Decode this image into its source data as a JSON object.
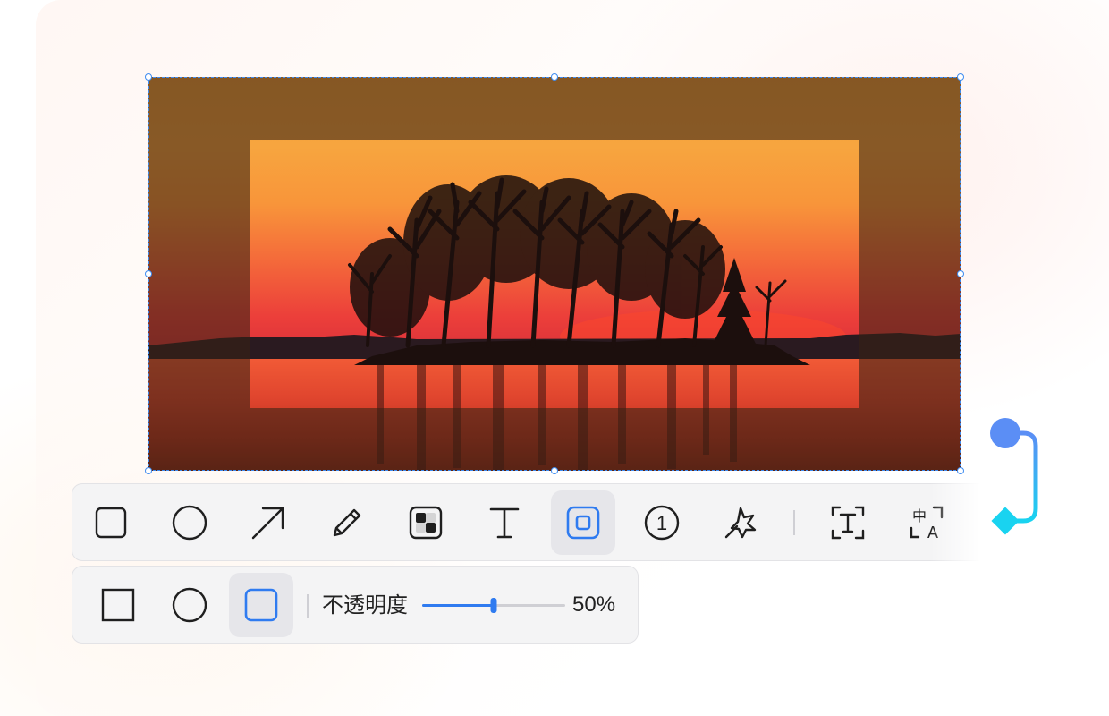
{
  "colors": {
    "accent": "#2f7bf0",
    "selection": "#3f8cf0",
    "toolbar_bg": "#f4f4f5",
    "active_tool_bg": "#e6e6ea",
    "icon": "#1f1f1f",
    "connector_top": "#5b8ef5",
    "connector_bottom": "#19d3f0"
  },
  "main_toolbar": {
    "tools": [
      {
        "name": "rectangle",
        "icon": "rectangle-icon",
        "active": false
      },
      {
        "name": "ellipse",
        "icon": "circle-icon",
        "active": false
      },
      {
        "name": "arrow",
        "icon": "arrow-icon",
        "active": false
      },
      {
        "name": "pen",
        "icon": "pencil-icon",
        "active": false
      },
      {
        "name": "mosaic",
        "icon": "mosaic-icon",
        "active": false
      },
      {
        "name": "text",
        "icon": "text-icon",
        "active": false
      },
      {
        "name": "spotlight",
        "icon": "spotlight-icon",
        "active": true
      },
      {
        "name": "number-marker",
        "icon": "numbered-marker-icon",
        "active": false
      },
      {
        "name": "magic",
        "icon": "magic-wand-icon",
        "active": false
      },
      {
        "name": "ocr",
        "icon": "ocr-text-icon",
        "active": false
      },
      {
        "name": "translate",
        "icon": "translate-icon",
        "active": false
      }
    ],
    "number_marker_glyph": "1",
    "translate_glyph": "中A"
  },
  "sub_toolbar": {
    "shapes": [
      {
        "name": "square",
        "icon": "square-shape-icon",
        "active": false
      },
      {
        "name": "circle",
        "icon": "circle-shape-icon",
        "active": false
      },
      {
        "name": "rounded-rect",
        "icon": "rounded-square-shape-icon",
        "active": true
      }
    ],
    "opacity_label": "不透明度",
    "opacity_value": "50%",
    "opacity_fraction": 0.5
  }
}
